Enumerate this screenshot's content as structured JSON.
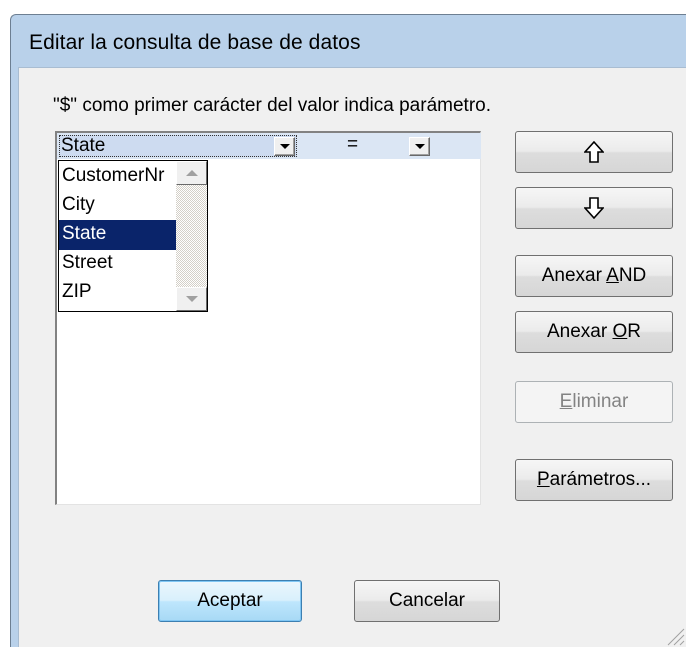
{
  "dialog": {
    "title": "Editar la consulta de base de datos",
    "hint": "\"$\" como primer carácter del valor indica parámetro."
  },
  "condition_row": {
    "field_value": "State",
    "operator": "="
  },
  "field_dropdown": {
    "options": [
      "CustomerNr",
      "City",
      "State",
      "Street",
      "ZIP"
    ],
    "selected": "State"
  },
  "buttons": {
    "move_up_icon": "arrow-up-icon",
    "move_down_icon": "arrow-down-icon",
    "append_and": {
      "prefix": "Anexar ",
      "mnemonic": "A",
      "rest": "ND"
    },
    "append_or": {
      "prefix": "Anexar ",
      "mnemonic": "O",
      "rest": "R"
    },
    "delete": {
      "mnemonic": "E",
      "rest": "liminar"
    },
    "parameters": {
      "mnemonic": "P",
      "rest": "arámetros..."
    },
    "ok": "Aceptar",
    "cancel": "Cancelar"
  },
  "colors": {
    "selection": "#0a246a",
    "title_bar": "#b9d1ea",
    "row_highlight": "#dbe6f4"
  }
}
